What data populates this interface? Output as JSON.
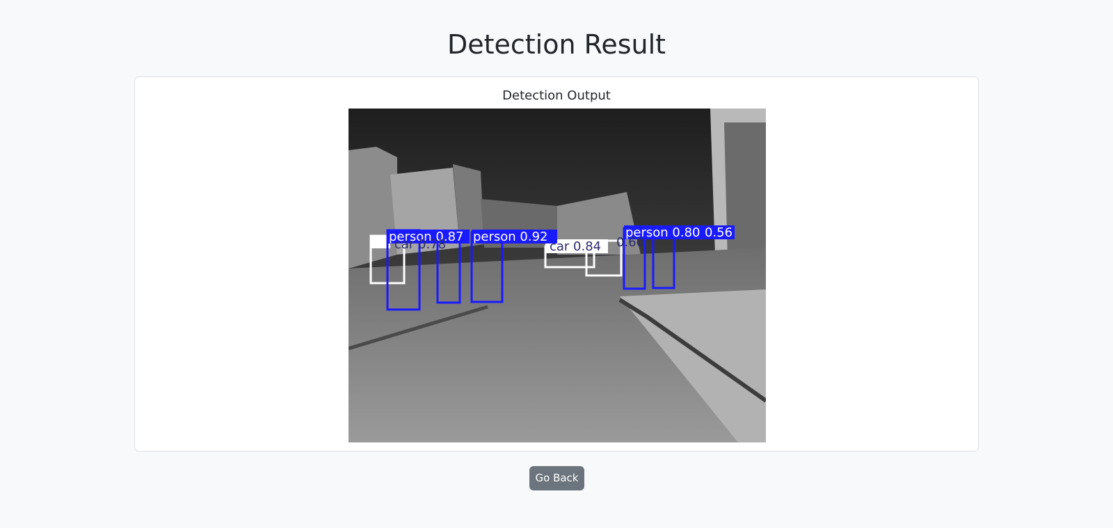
{
  "page": {
    "title": "Detection Result"
  },
  "card": {
    "title": "Detection Output"
  },
  "detections": [
    {
      "label": "person 0.87",
      "class": "person",
      "score": 0.87
    },
    {
      "label": "person 0.92",
      "class": "person",
      "score": 0.92
    },
    {
      "label": "person 0.80",
      "class": "person",
      "score": 0.8
    },
    {
      "label": "0.56",
      "class": "person",
      "score": 0.56
    },
    {
      "label": "car 0.84",
      "class": "car",
      "score": 0.84
    },
    {
      "label": "0.60",
      "class": "person",
      "score": 0.6
    },
    {
      "label": "car 0.78",
      "class": "car",
      "score": 0.78
    }
  ],
  "actions": {
    "go_back_label": "Go Back"
  },
  "colors": {
    "page_background": "#f8f9fa",
    "person_box": "#1a1aff",
    "car_box": "#ffffff",
    "button_secondary": "#6c757d"
  }
}
